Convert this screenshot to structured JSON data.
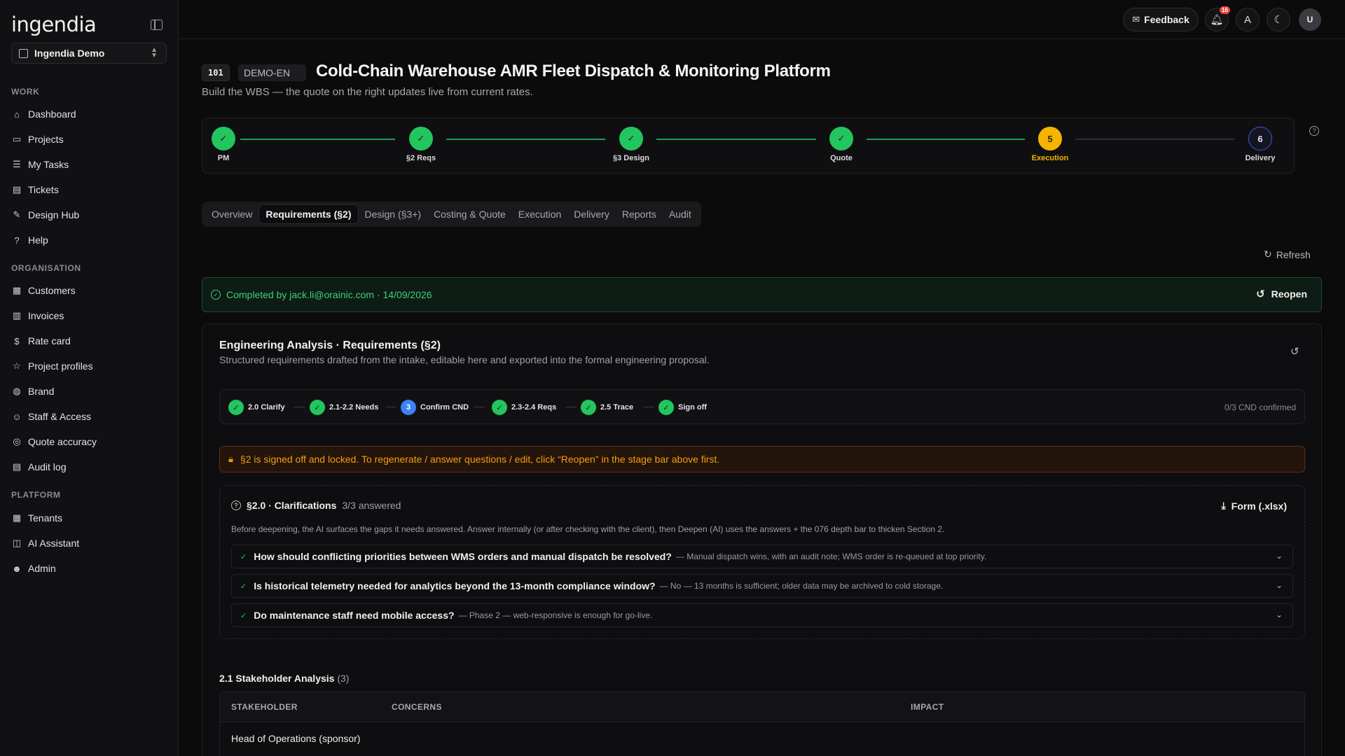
{
  "sidebar": {
    "logo": "ingendia",
    "org": "Ingendia Demo",
    "sections": {
      "work": "WORK",
      "organisation": "ORGANISATION",
      "platform": "PLATFORM"
    },
    "work_items": [
      {
        "label": "Dashboard",
        "icon": "home-icon"
      },
      {
        "label": "Projects",
        "icon": "folder-icon"
      },
      {
        "label": "My Tasks",
        "icon": "tasks-icon"
      },
      {
        "label": "Tickets",
        "icon": "ticket-icon"
      },
      {
        "label": "Design Hub",
        "icon": "design-icon"
      },
      {
        "label": "Help",
        "icon": "help-icon"
      }
    ],
    "org_items": [
      {
        "label": "Customers",
        "icon": "building-icon"
      },
      {
        "label": "Invoices",
        "icon": "invoice-icon"
      },
      {
        "label": "Rate card",
        "icon": "dollar-icon"
      },
      {
        "label": "Project profiles",
        "icon": "star-icon"
      },
      {
        "label": "Brand",
        "icon": "palette-icon"
      },
      {
        "label": "Staff & Access",
        "icon": "users-icon"
      },
      {
        "label": "Quote accuracy",
        "icon": "target-icon"
      },
      {
        "label": "Audit log",
        "icon": "log-icon"
      }
    ],
    "platform_items": [
      {
        "label": "Tenants",
        "icon": "building-icon"
      },
      {
        "label": "AI Assistant",
        "icon": "bot-icon"
      },
      {
        "label": "Admin",
        "icon": "admin-icon"
      }
    ]
  },
  "topbar": {
    "feedback": "Feedback",
    "notif_count": "16",
    "avatar": "U"
  },
  "project": {
    "id": "101",
    "code": "DEMO-EN",
    "title": "Cold-Chain Warehouse AMR Fleet Dispatch & Monitoring Platform",
    "subtitle": "Build the WBS — the quote on the right updates live from current rates."
  },
  "stages": [
    {
      "label": "PM",
      "state": "done",
      "num": ""
    },
    {
      "label": "§2 Reqs",
      "state": "done",
      "num": ""
    },
    {
      "label": "§3 Design",
      "state": "done",
      "num": ""
    },
    {
      "label": "Quote",
      "state": "done",
      "num": ""
    },
    {
      "label": "Execution",
      "state": "current",
      "num": "5"
    },
    {
      "label": "Delivery",
      "state": "todo",
      "num": "6"
    }
  ],
  "tabs": [
    "Overview",
    "Requirements (§2)",
    "Design (§3+)",
    "Costing & Quote",
    "Execution",
    "Delivery",
    "Reports",
    "Audit"
  ],
  "active_tab": "Requirements (§2)",
  "refresh": "Refresh",
  "completed": {
    "text": "Completed by jack.li@orainic.com · 14/09/2026",
    "reopen": "Reopen"
  },
  "analysis": {
    "title": "Engineering Analysis · Requirements (§2)",
    "subtitle": "Structured requirements drafted from the intake, editable here and exported into the formal engineering proposal.",
    "substeps": [
      {
        "label": "2.0 Clarify",
        "state": "done",
        "num": ""
      },
      {
        "label": "2.1-2.2 Needs",
        "state": "done",
        "num": ""
      },
      {
        "label": "Confirm CND",
        "state": "current",
        "num": "3"
      },
      {
        "label": "2.3-2.4 Reqs",
        "state": "done",
        "num": ""
      },
      {
        "label": "2.5 Trace",
        "state": "done",
        "num": ""
      },
      {
        "label": "Sign off",
        "state": "done",
        "num": ""
      }
    ],
    "cnd_status": "0/3 CND confirmed",
    "locked_msg": "§2 is signed off and locked. To regenerate / answer questions / edit, click “Reopen” in the stage bar above first."
  },
  "clarifications": {
    "title": "§2.0 · Clarifications",
    "count": "3/3 answered",
    "form_btn": "Form (.xlsx)",
    "desc": "Before deepening, the AI surfaces the gaps it needs answered. Answer internally (or after checking with the client), then Deepen (AI) uses the answers + the 076 depth bar to thicken Section 2.",
    "items": [
      {
        "q": "How should conflicting priorities between WMS orders and manual dispatch be resolved?",
        "a": "— Manual dispatch wins, with an audit note; WMS order is re-queued at top priority."
      },
      {
        "q": "Is historical telemetry needed for analytics beyond the 13-month compliance window?",
        "a": "— No — 13 months is sufficient; older data may be archived to cold storage."
      },
      {
        "q": "Do maintenance staff need mobile access?",
        "a": "— Phase 2 — web-responsive is enough for go-live."
      }
    ]
  },
  "stakeholders": {
    "title": "2.1 Stakeholder Analysis",
    "count": "(3)",
    "headers": [
      "STAKEHOLDER",
      "CONCERNS",
      "IMPACT"
    ],
    "rows": [
      [
        "Head of Operations (sponsor)",
        "",
        ""
      ]
    ]
  }
}
